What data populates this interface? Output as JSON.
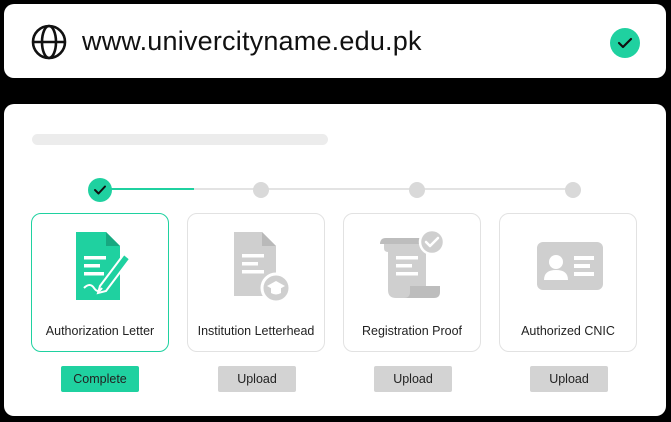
{
  "url_bar": {
    "url": "www.univercityname.edu.pk",
    "icon": "globe-icon",
    "status_icon": "verified-check-icon"
  },
  "colors": {
    "accent": "#1fd1a0",
    "inactive": "#d9d9d9",
    "upload_button": "#d3d3d3"
  },
  "steps": [
    {
      "state": "complete"
    },
    {
      "state": "pending"
    },
    {
      "state": "pending"
    },
    {
      "state": "pending"
    }
  ],
  "documents": [
    {
      "label": "Authorization Letter",
      "icon": "signed-document-icon",
      "status": "complete",
      "button": "Complete"
    },
    {
      "label": "Institution Letterhead",
      "icon": "letterhead-document-icon",
      "status": "pending",
      "button": "Upload"
    },
    {
      "label": "Registration Proof",
      "icon": "certificate-scroll-icon",
      "status": "pending",
      "button": "Upload"
    },
    {
      "label": "Authorized CNIC",
      "icon": "id-card-icon",
      "status": "pending",
      "button": "Upload"
    }
  ]
}
